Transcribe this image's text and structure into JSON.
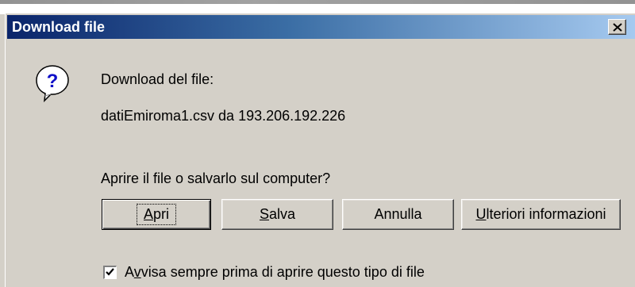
{
  "dialog": {
    "title": "Download file",
    "close_icon": "close-icon",
    "question_icon": "question-icon",
    "heading": "Download del file:",
    "file_info": "datiEmiroma1.csv da 193.206.192.226",
    "prompt": "Aprire il file o salvarlo sul computer?"
  },
  "buttons": {
    "apri": {
      "pre": "",
      "mnemonic": "A",
      "post": "pri"
    },
    "salva": {
      "pre": "",
      "mnemonic": "S",
      "post": "alva"
    },
    "annulla": {
      "label": "Annulla"
    },
    "ulteriori": {
      "pre": "",
      "mnemonic": "U",
      "post": "lteriori informazioni"
    }
  },
  "checkbox": {
    "checked": true,
    "pre": "A",
    "mnemonic": "v",
    "post": "visa sempre prima di aprire questo tipo di file"
  },
  "colors": {
    "titlebar_start": "#0a246a",
    "titlebar_end": "#a6caf0",
    "face": "#d4d0c8"
  }
}
